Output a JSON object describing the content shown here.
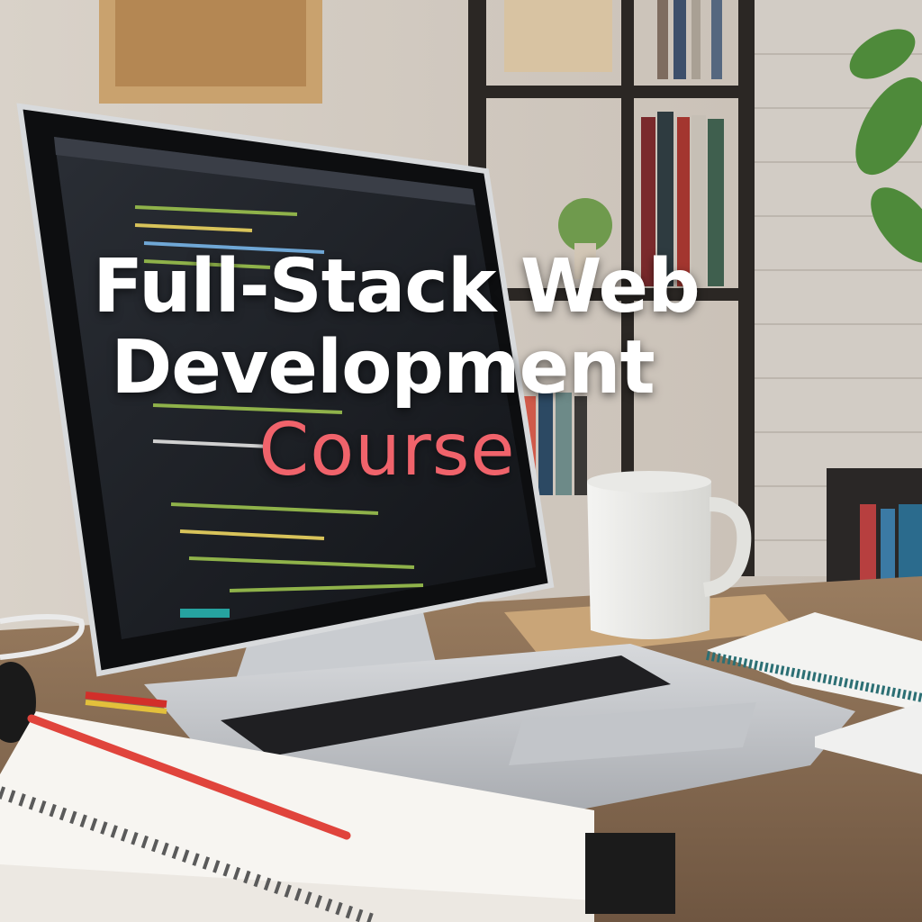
{
  "overlay": {
    "line1": "Full-Stack Web",
    "line2": "Development",
    "line3": "Course"
  },
  "colors": {
    "title_text": "#ffffff",
    "accent_text": "#f0636b",
    "screen_bg": "#1f2227",
    "desk": "#8a6f55"
  }
}
